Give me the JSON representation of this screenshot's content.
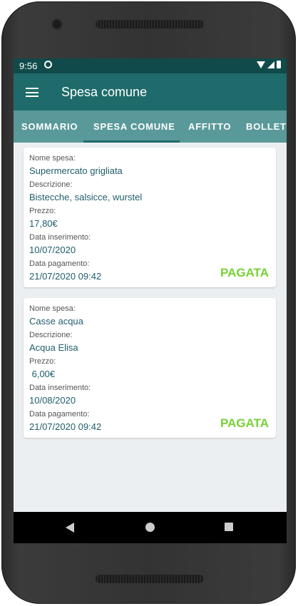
{
  "status_bar": {
    "time": "9:56"
  },
  "app_bar": {
    "title": "Spesa comune"
  },
  "tabs": [
    {
      "label": "SOMMARIO"
    },
    {
      "label": "SPESA COMUNE"
    },
    {
      "label": "AFFITTO"
    },
    {
      "label": "BOLLETTE"
    }
  ],
  "labels": {
    "name": "Nome spesa:",
    "description": "Descrizione:",
    "price": "Prezzo:",
    "date_inserted": "Data inserimento:",
    "date_paid": "Data pagamento:"
  },
  "expenses": [
    {
      "name": "Supermercato grigliata",
      "description": "Bistecche, salsicce, wurstel",
      "price": "17,80€",
      "date_inserted": "10/07/2020",
      "date_paid": "21/07/2020 09:42",
      "status": "PAGATA"
    },
    {
      "name": "Casse acqua",
      "description": "Acqua Elisa",
      "price": " 6,00€",
      "date_inserted": "10/08/2020",
      "date_paid": "21/07/2020 09:42",
      "status": "PAGATA"
    }
  ],
  "colors": {
    "status_bar": "#104a4a",
    "app_bar": "#1f6b6b",
    "tab_bar": "#5a9999",
    "paid_status": "#76d233",
    "value_text": "#1f5d6b"
  },
  "icons": {
    "menu": "menu-icon",
    "nav_back": "back-icon",
    "nav_home": "home-icon",
    "nav_recent": "recent-apps-icon"
  }
}
